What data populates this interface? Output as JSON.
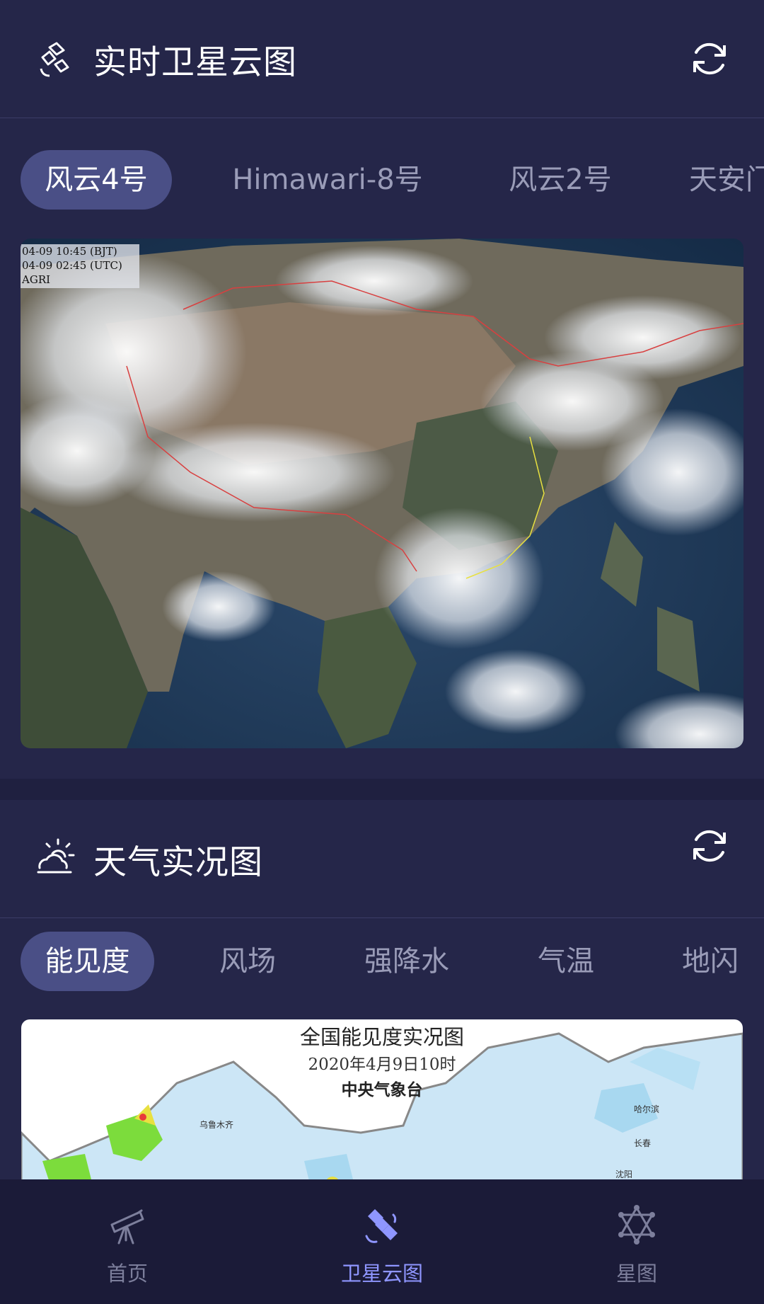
{
  "satellite_section": {
    "title": "实时卫星云图",
    "tabs": [
      "风云4号",
      "Himawari-8号",
      "风云2号",
      "天安门"
    ],
    "active_tab": 0,
    "image_stamp": {
      "line1": "04-09 10:45 (BJT)",
      "line2": "04-09 02:45 (UTC)",
      "line3": "AGRI"
    }
  },
  "weather_section": {
    "title": "天气实况图",
    "tabs": [
      "能见度",
      "风场",
      "强降水",
      "气温",
      "地闪"
    ],
    "active_tab": 0,
    "map": {
      "title": "全国能见度实况图",
      "subtitle": "2020年4月9日10时",
      "agency": "中央气象台",
      "cities": [
        "乌鲁木齐",
        "哈尔滨",
        "长春",
        "沈阳"
      ]
    }
  },
  "bottom_nav": {
    "items": [
      {
        "label": "首页",
        "icon": "telescope-icon"
      },
      {
        "label": "卫星云图",
        "icon": "satellite-icon"
      },
      {
        "label": "星图",
        "icon": "star-chart-icon"
      }
    ],
    "active": 1
  },
  "colors": {
    "background": "#252649",
    "active_tab": "#4a4f86",
    "nav_active": "#8f96ff",
    "nav_inactive": "#7d7f9c"
  }
}
